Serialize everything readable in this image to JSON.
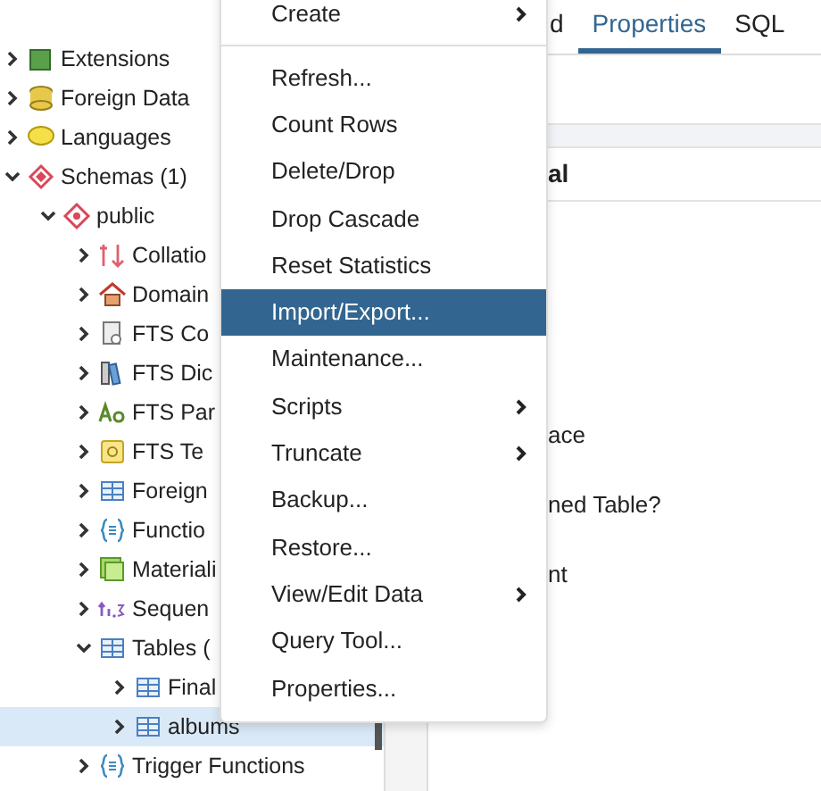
{
  "tree": [
    {
      "label": "Extensions",
      "kind": "extension",
      "expanded": false,
      "selected": false
    },
    {
      "label": "Foreign Data",
      "kind": "fdw",
      "expanded": false,
      "selected": false
    },
    {
      "label": "Languages",
      "kind": "language",
      "expanded": false,
      "selected": false
    },
    {
      "label": "Schemas (1)",
      "kind": "schemas",
      "expanded": true,
      "selected": false,
      "children": [
        {
          "label": "public",
          "kind": "schema",
          "expanded": true,
          "selected": false,
          "children": [
            {
              "label": "Collatio",
              "kind": "collation",
              "expanded": false,
              "selected": false
            },
            {
              "label": "Domain",
              "kind": "domain",
              "expanded": false,
              "selected": false
            },
            {
              "label": "FTS Co",
              "kind": "ftsconfig",
              "expanded": false,
              "selected": false
            },
            {
              "label": "FTS Dic",
              "kind": "ftsdict",
              "expanded": false,
              "selected": false
            },
            {
              "label": "FTS Par",
              "kind": "ftsparser",
              "expanded": false,
              "selected": false
            },
            {
              "label": "FTS Te",
              "kind": "ftstemplate",
              "expanded": false,
              "selected": false
            },
            {
              "label": "Foreign",
              "kind": "foreigntable",
              "expanded": false,
              "selected": false
            },
            {
              "label": "Functio",
              "kind": "function",
              "expanded": false,
              "selected": false
            },
            {
              "label": "Materiali",
              "kind": "matview",
              "expanded": false,
              "selected": false
            },
            {
              "label": "Sequen",
              "kind": "sequence",
              "expanded": false,
              "selected": false
            },
            {
              "label": "Tables (",
              "kind": "tables",
              "expanded": true,
              "selected": false,
              "children": [
                {
                  "label": "Final",
                  "kind": "table",
                  "expanded": false,
                  "selected": false
                },
                {
                  "label": "albums",
                  "kind": "table",
                  "expanded": false,
                  "selected": true
                }
              ]
            },
            {
              "label": "Trigger Functions",
              "kind": "function",
              "expanded": false,
              "selected": false
            }
          ]
        }
      ]
    }
  ],
  "tabs": [
    {
      "label": "d",
      "selected": false
    },
    {
      "label": "Properties",
      "selected": true
    },
    {
      "label": "SQL",
      "selected": false
    }
  ],
  "properties": {
    "section": "al",
    "labels": [
      "ace",
      "ned Table?",
      "nt"
    ]
  },
  "context_menu": [
    {
      "label": "Create",
      "submenu": true,
      "selected": false,
      "separator_after": true
    },
    {
      "label": "Refresh...",
      "submenu": false,
      "selected": false
    },
    {
      "label": "Count Rows",
      "submenu": false,
      "selected": false
    },
    {
      "label": "Delete/Drop",
      "submenu": false,
      "selected": false
    },
    {
      "label": "Drop Cascade",
      "submenu": false,
      "selected": false
    },
    {
      "label": "Reset Statistics",
      "submenu": false,
      "selected": false
    },
    {
      "label": "Import/Export...",
      "submenu": false,
      "selected": true
    },
    {
      "label": "Maintenance...",
      "submenu": false,
      "selected": false
    },
    {
      "label": "Scripts",
      "submenu": true,
      "selected": false
    },
    {
      "label": "Truncate",
      "submenu": true,
      "selected": false
    },
    {
      "label": "Backup...",
      "submenu": false,
      "selected": false
    },
    {
      "label": "Restore...",
      "submenu": false,
      "selected": false
    },
    {
      "label": "View/Edit Data",
      "submenu": true,
      "selected": false
    },
    {
      "label": "Query Tool...",
      "submenu": false,
      "selected": false
    },
    {
      "label": "Properties...",
      "submenu": false,
      "selected": false
    }
  ]
}
